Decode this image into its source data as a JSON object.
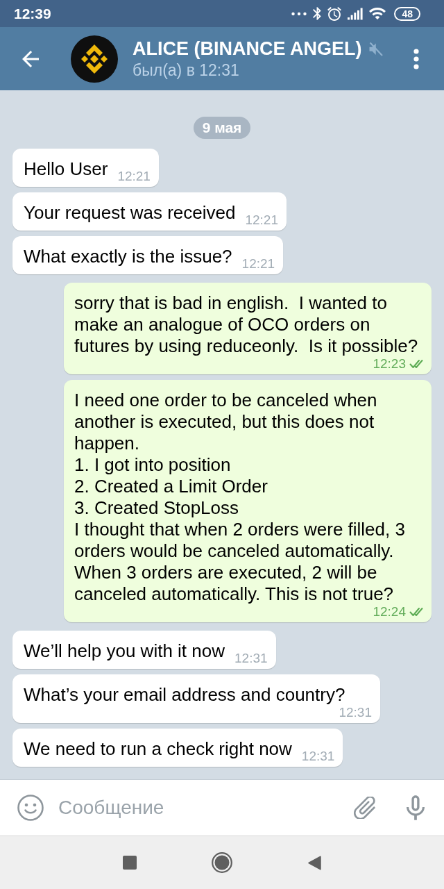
{
  "status_bar": {
    "time": "12:39",
    "battery": "48"
  },
  "header": {
    "title": "ALICE (BINANCE ANGEL)",
    "muted": true,
    "subtitle": "был(а) в 12:31"
  },
  "chat": {
    "date": "9 мая",
    "messages": [
      {
        "kind": "incoming",
        "text": "Hello User",
        "time": "12:21"
      },
      {
        "kind": "incoming",
        "text": "Your request was received",
        "time": "12:21"
      },
      {
        "kind": "incoming",
        "text": "What exactly is the issue?",
        "time": "12:21"
      },
      {
        "kind": "outgoing",
        "text": "sorry that is bad in english.  I wanted to make an analogue of OCO orders on futures by using reduceonly.  Is it possible?",
        "time": "12:23",
        "read": true
      },
      {
        "kind": "outgoing",
        "text": "I need one order to be canceled when another is executed, but this does not happen.\n1. I got into position\n2. Created a Limit Order\n3. Created StopLoss\nI thought that when 2 orders were filled, 3 orders would be canceled automatically.\nWhen 3 orders are executed, 2 will be canceled automatically. This is not true?",
        "time": "12:24",
        "read": true
      },
      {
        "kind": "incoming",
        "text": "We’ll help you with it now",
        "time": "12:31"
      },
      {
        "kind": "incoming",
        "text": "What’s your email address and country?",
        "time": "12:31"
      },
      {
        "kind": "incoming",
        "text": "We need to run a check right now",
        "time": "12:31"
      }
    ]
  },
  "composer": {
    "placeholder": "Сообщение"
  }
}
